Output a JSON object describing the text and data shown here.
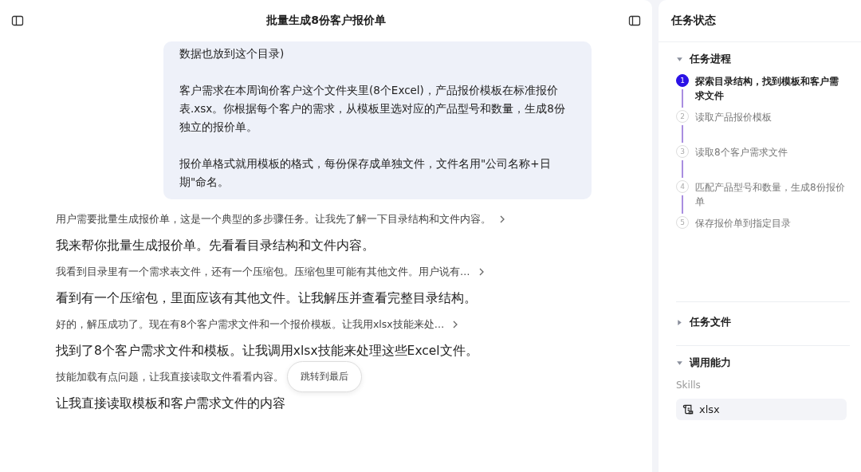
{
  "header": {
    "title": "批量生成8份客户报价单"
  },
  "user_message": {
    "paragraphs": [
      "数据也放到这个目录)",
      "客户需求在本周询价客户这个文件夹里(8个Excel)，产品报价模板在标准报价表.xsx。你根据每个客户的需求，从模板里选对应的产品型号和数量，生成8份独立的报价单。",
      "报价单格式就用模板的格式，每份保存成单独文件，文件名用\"公司名称+日期\"命名。"
    ]
  },
  "messages": [
    {
      "kind": "thought",
      "text": "用户需要批量生成报价单，这是一个典型的多步骤任务。让我先了解一下目录结构和文件内容。",
      "expandable": true
    },
    {
      "kind": "reply",
      "text": "我来帮你批量生成报价单。先看看目录结构和文件内容。"
    },
    {
      "kind": "thought",
      "text": "我看到目录里有一个需求表文件，还有一个压缩包。压缩包里可能有其他文件。用户说有…",
      "expandable": true
    },
    {
      "kind": "reply",
      "text": "看到有一个压缩包，里面应该有其他文件。让我解压并查看完整目录结构。"
    },
    {
      "kind": "thought",
      "text": "好的，解压成功了。现在有8个客户需求文件和一个报价模板。让我用xlsx技能来处…",
      "expandable": true
    },
    {
      "kind": "reply",
      "text": "找到了8个客户需求文件和模板。让我调用xlsx技能来处理这些Excel文件。"
    },
    {
      "kind": "thought",
      "text": "技能加载有点问题，让我直接读取文件看看内容。"
    },
    {
      "kind": "reply",
      "text": "让我直接读取模板和客户需求文件的内容"
    }
  ],
  "jump_button": {
    "label": "跳转到最后"
  },
  "panel": {
    "title": "任务状态",
    "progress": {
      "title": "任务进程",
      "expanded": true,
      "steps": [
        {
          "number": "1",
          "label": "探索目录结构，找到模板和客户需求文件",
          "selected": true
        },
        {
          "number": "2",
          "label": "读取产品报价模板",
          "selected": false
        },
        {
          "number": "3",
          "label": "读取8个客户需求文件",
          "selected": false
        },
        {
          "number": "4",
          "label": "匹配产品型号和数量，生成8份报价单",
          "selected": false
        },
        {
          "number": "5",
          "label": "保存报价单到指定目录",
          "selected": false
        }
      ]
    },
    "files": {
      "title": "任务文件",
      "expanded": false
    },
    "capabilities": {
      "title": "调用能力",
      "expanded": true,
      "group_label": "Skills",
      "skills": [
        {
          "name": "xlsx"
        }
      ]
    }
  }
}
